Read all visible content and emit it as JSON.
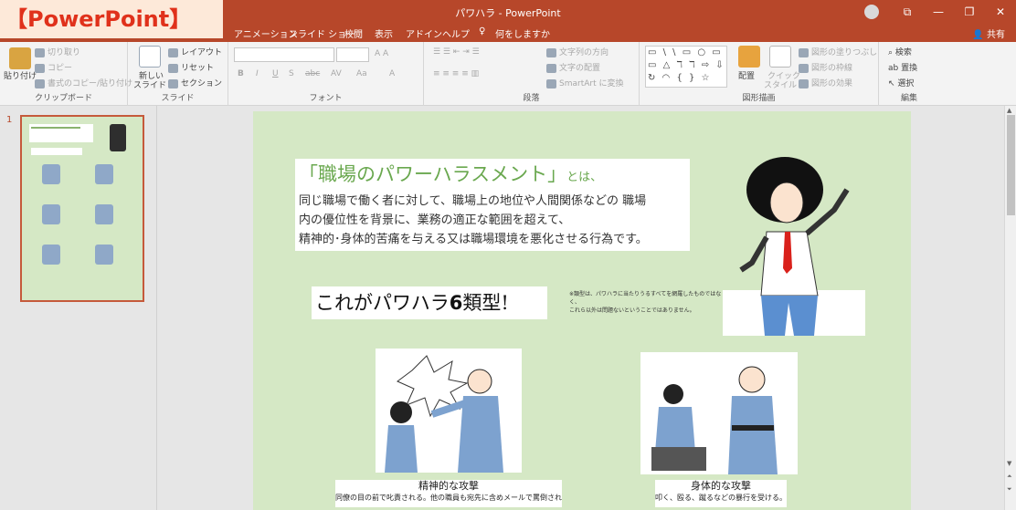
{
  "overlay_tag": "【PowerPoint】",
  "window": {
    "title": "パワハラ  -  PowerPoint",
    "share": "共有"
  },
  "tabs": [
    "アニメーション",
    "スライド ショー",
    "校閲",
    "表示",
    "アドイン",
    "ヘルプ"
  ],
  "tell_me": "何をしますか",
  "ribbon": {
    "clipboard": {
      "paste": "貼り付け",
      "cut": "切り取り",
      "copy": "コピー",
      "format_painter": "書式のコピー/貼り付け",
      "label": "クリップボード"
    },
    "slides": {
      "new_slide_1": "新しい",
      "new_slide_2": "スライド",
      "layout": "レイアウト",
      "reset": "リセット",
      "section": "セクション",
      "label": "スライド"
    },
    "font": {
      "bold": "B",
      "italic": "I",
      "underline": "U",
      "shadow": "S",
      "strike": "abc",
      "spacing": "AV",
      "case": "Aa",
      "color": "A",
      "label": "フォント"
    },
    "paragraph": {
      "text_direction": "文字列の方向",
      "align_text": "文字の配置",
      "smartart": "SmartArt に変換",
      "label": "段落"
    },
    "drawing": {
      "arrange": "配置",
      "quick_styles_1": "クイック",
      "quick_styles_2": "スタイル",
      "fill": "図形の塗りつぶし",
      "outline": "図形の枠線",
      "effects": "図形の効果",
      "label": "図形描画"
    },
    "editing": {
      "find": "検索",
      "replace": "置換",
      "select": "選択",
      "label": "編集"
    }
  },
  "thumbnail": {
    "number": "1",
    "mini_title": "「職場のパワーハラスメント」",
    "mini_types": "これがパワハラ6類型"
  },
  "slide": {
    "title": "「職場のパワーハラスメント」",
    "title_suffix": "とは、",
    "body": [
      "同じ職場で働く者に対して、職場上の地位や人間関係などの 職場",
      "内の優位性を背景に、業務の適正な範囲を超えて、",
      "精神的･身体的苦痛を与える又は職場環境を悪化させる行為です。"
    ],
    "types_prefix": "これがパワハラ",
    "types_number": "6",
    "types_suffix": "類型!",
    "note": [
      "※類型は、パワハラに当たりうるすべてを網羅したものではなく、",
      "これら以外は問題ないということではありません。"
    ],
    "captions": [
      {
        "title": "精神的な攻撃",
        "desc": "同僚の目の前で叱責される。他の職員も宛先に含めメールで罵倒され"
      },
      {
        "title": "身体的な攻撃",
        "desc": "叩く、殴る、蹴るなどの暴行を受ける。"
      }
    ]
  },
  "colors": {
    "accent": "#b7472a",
    "slide_bg": "#d5e8c5",
    "title_green": "#6aa84f",
    "tag_red": "#e0311b"
  }
}
